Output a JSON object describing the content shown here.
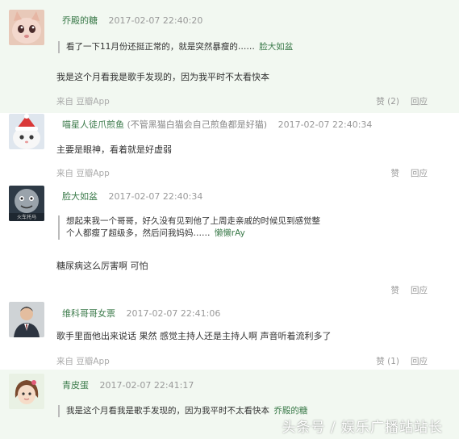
{
  "comments": [
    {
      "avatar_icon": "pink-cat-face-icon",
      "username": "乔殿的糖",
      "tag": "",
      "time": "2017-02-07 22:40:20",
      "quote": {
        "text": "看了一下11月份还挺正常的，就是突然暴瘦的……",
        "name": "脸大如盆"
      },
      "body": "我是这个月看我是歌手发现的，因为我平时不太看快本",
      "source": "来自 豆瓣App",
      "like": "赞 (2)",
      "reply": "回应"
    },
    {
      "avatar_icon": "white-cat-santa-hat-icon",
      "username": "喵星人徒爪煎鱼",
      "tag": "(不管黑猫白猫会自己煎鱼都是好猫)",
      "time": "2017-02-07 22:40:34",
      "body": "主要是眼神，看着就是好虚弱",
      "source": "来自 豆瓣App",
      "like": "赞",
      "reply": "回应"
    },
    {
      "avatar_icon": "thomas-train-face-icon",
      "avatar_text": "火车托马",
      "username": "脸大如盆",
      "tag": "",
      "time": "2017-02-07 22:40:34",
      "quote": {
        "text": "想起来我一个哥哥，好久没有见到他了上周走亲戚的时候见到感觉整个人都瘦了超级多，然后问我妈妈……",
        "name": "懒懒rAy"
      },
      "body": "糖尿病这么厉害啊 可怕",
      "source": "",
      "like": "赞",
      "reply": "回应"
    },
    {
      "avatar_icon": "man-in-suit-icon",
      "username": "维科哥哥女票",
      "tag": "",
      "time": "2017-02-07 22:41:06",
      "body": "歌手里面他出来说话 果然 感觉主持人还是主持人啊 声音听着流利多了",
      "source": "来自 豆瓣App",
      "like": "赞 (1)",
      "reply": "回应"
    },
    {
      "avatar_icon": "cartoon-girl-icon",
      "username": "青皮蛋",
      "tag": "",
      "time": "2017-02-07 22:41:17",
      "quote": {
        "text": "我是这个月看我是歌手发现的，因为我平时不太看快本",
        "name": "乔殿的糖"
      }
    }
  ],
  "watermark": "头条号 / 娱乐广播站站长",
  "colors": {
    "username": "#3b7a4a",
    "highlight_bg": "#f2f8f1",
    "muted": "#999999"
  }
}
